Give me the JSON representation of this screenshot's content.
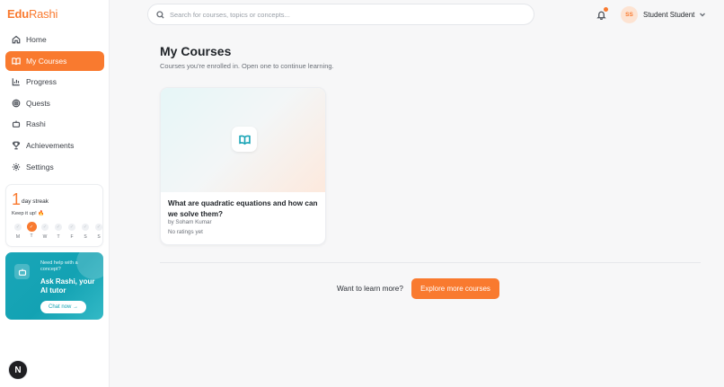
{
  "app": {
    "logo_a": "Edu",
    "logo_b": "Rashi"
  },
  "sidebar": {
    "items": [
      {
        "label": "Home",
        "icon": "home-icon"
      },
      {
        "label": "My Courses",
        "icon": "book-icon",
        "active": true
      },
      {
        "label": "Progress",
        "icon": "chart-icon"
      },
      {
        "label": "Quests",
        "icon": "target-icon"
      },
      {
        "label": "Rashi",
        "icon": "bot-icon"
      },
      {
        "label": "Achievements",
        "icon": "trophy-icon"
      },
      {
        "label": "Settings",
        "icon": "gear-icon"
      }
    ]
  },
  "streak": {
    "count": "1",
    "label": "day streak",
    "message": "Keep it up!",
    "days": [
      {
        "letter": "M",
        "done": false
      },
      {
        "letter": "T",
        "done": true
      },
      {
        "letter": "W",
        "done": false
      },
      {
        "letter": "T",
        "done": false
      },
      {
        "letter": "F",
        "done": false
      },
      {
        "letter": "S",
        "done": false
      },
      {
        "letter": "S",
        "done": false
      }
    ]
  },
  "tutor": {
    "question": "Need help with a concept?",
    "title": "Ask Rashi, your AI tutor",
    "cta": "Chat now"
  },
  "bottom_avatar": "N",
  "search": {
    "placeholder": "Search for courses, topics or concepts..."
  },
  "user": {
    "initials": "SS",
    "name": "Student Student"
  },
  "main": {
    "title": "My Courses",
    "subtitle": "Courses you're enrolled in. Open one to continue learning.",
    "courses": [
      {
        "title": "What are quadratic equations and how can we solve them?",
        "author": "by Soham Kumar",
        "rating": "No ratings yet"
      }
    ],
    "more_prompt": "Want to learn more?",
    "explore_label": "Explore more courses"
  },
  "colors": {
    "accent": "#f97a2f",
    "teal": "#13a2b3"
  }
}
